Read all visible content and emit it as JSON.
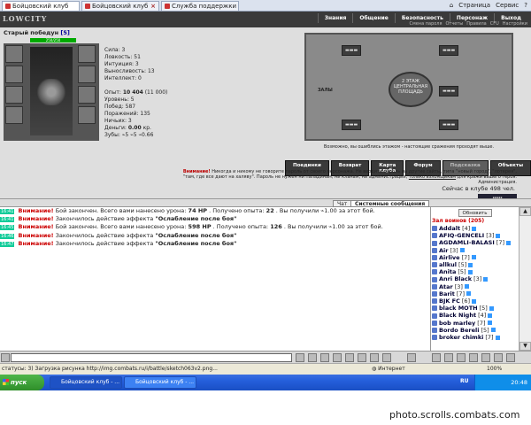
{
  "browser": {
    "tabs": [
      {
        "label": "Бойцовский клуб"
      },
      {
        "label": "Бойцовский клуб"
      },
      {
        "label": "Служба поддержки Бойцов..."
      }
    ],
    "tools": [
      "Страница",
      "Сервис"
    ]
  },
  "game": {
    "logo": "LOWCITY",
    "nav": [
      "Знания",
      "Общение",
      "Безопасность",
      "Персонаж",
      "Выход"
    ],
    "subnav": [
      "Смена пароля",
      "Отчеты",
      "Правила",
      "CFU",
      "Настройки"
    ],
    "player": {
      "name": "Старый победун",
      "level": "[5]",
      "hp": "250/250"
    },
    "stats": {
      "strength": "Сила: 3",
      "agility": "Ловкость: 51",
      "intuition": "Интуиция: 3",
      "endurance": "Выносливость: 13",
      "intellect": "Интеллект: 0",
      "exp_label": "Опыт:",
      "exp_value": "10 404",
      "exp_next": "(11 000)",
      "levels": "Уровень: 5",
      "wins": "Побед: 587",
      "losses": "Поражений: 135",
      "draws": "Ничьих: 3",
      "money_label": "Деньги:",
      "money_value": "0.00",
      "money_unit": "кр.",
      "teeth": "Зубы: ⌁5 ⌁5 ⌁0.66"
    },
    "map": {
      "floor": "2 ЭТАЖ",
      "center": "ЦЕНТРАЛЬНАЯ ПЛОЩАДЬ",
      "halls": "ЗАЛЫ",
      "hint": "Возможно, вы ошиблись этажом - настоящие сражения проходят выше."
    },
    "buttons": [
      "Поединки",
      "Возврат",
      "Карта клуба",
      "Форум",
      "Подсказка",
      "Объекты"
    ],
    "warning_title": "Внимание!",
    "warning_text": "Никогда и никому не говорите пароль от своего персонажа. Не вводите пароль на другие сайты, типа \"новый город\", \"лотерея\", \"там, где все дают на халяву\". Пароль не нужен ни паладинам, ни кланам, ни администрации,",
    "warning_link": "только взломщикам",
    "warning_tail": "для кражи вашего героя.",
    "admin": "Администрация.",
    "online": "Сейчас в клубе 498 чел."
  },
  "chat": {
    "tabs": [
      "Чат",
      "Системные сообщения"
    ],
    "lines": [
      {
        "time": "16:41",
        "warn": "Внимание!",
        "text": "Бой закончен. Всего вами нанесено урона:",
        "bold1": "74 HP",
        "mid": ". Получено опыта:",
        "bold2": "22",
        "tail": ". Вы получили ⌁1.00 за этот бой."
      },
      {
        "time": "16:41",
        "warn": "Внимание!",
        "text": "Закончилось действие эффекта",
        "bold1": "\"Ослабление после боя\"",
        "mid": "",
        "bold2": "",
        "tail": ""
      },
      {
        "time": "16:45",
        "warn": "Внимание!",
        "text": "Бой закончен. Всего вами нанесено урона:",
        "bold1": "598 HP",
        "mid": ". Получено опыта:",
        "bold2": "126",
        "tail": ". Вы получили ⌁1.00 за этот бой."
      },
      {
        "time": "16:46",
        "warn": "Внимание!",
        "text": "Закончилось действие эффекта",
        "bold1": "\"Ослабление после боя\"",
        "mid": "",
        "bold2": "",
        "tail": ""
      },
      {
        "time": "16:47",
        "warn": "Внимание!",
        "text": "Закончилось действие эффекта",
        "bold1": "\"Ослабление после боя\"",
        "mid": "",
        "bold2": "",
        "tail": ""
      }
    ]
  },
  "players": {
    "refresh": "Обновить",
    "room": "Зал воинов (205)",
    "list": [
      {
        "name": "Addalt",
        "level": "[4]"
      },
      {
        "name": "AFIQ-GENCELI",
        "level": "[3]"
      },
      {
        "name": "AGDAMLI-BALASI",
        "level": "[7]"
      },
      {
        "name": "Air",
        "level": "[3]"
      },
      {
        "name": "Airlive",
        "level": "[7]"
      },
      {
        "name": "allkul",
        "level": "[5]"
      },
      {
        "name": "Anita",
        "level": "[5]"
      },
      {
        "name": "Anri Black",
        "level": "[3]"
      },
      {
        "name": "Atar",
        "level": "[3]"
      },
      {
        "name": "Barit",
        "level": "[7]"
      },
      {
        "name": "BJK FC",
        "level": "[6]"
      },
      {
        "name": "black MOTH",
        "level": "[5]"
      },
      {
        "name": "Black Night",
        "level": "[4]"
      },
      {
        "name": "bob marley",
        "level": "[7]"
      },
      {
        "name": "Bordo Bereli",
        "level": "[5]"
      },
      {
        "name": "broker chimki",
        "level": "[7]"
      }
    ]
  },
  "status": {
    "url": "статусы: 3) Загрузка рисунка http://img.combats.ru/i/battle/sketch063v2.png...",
    "zone": "Интернет",
    "zoom": "100%"
  },
  "taskbar": {
    "start": "пуск",
    "tasks": [
      "Бойцовский клуб - ...",
      "Бойцовский клуб - ..."
    ],
    "lang": "RU",
    "clock": "20:48"
  },
  "footer": "photo.scrolls.combats.com"
}
